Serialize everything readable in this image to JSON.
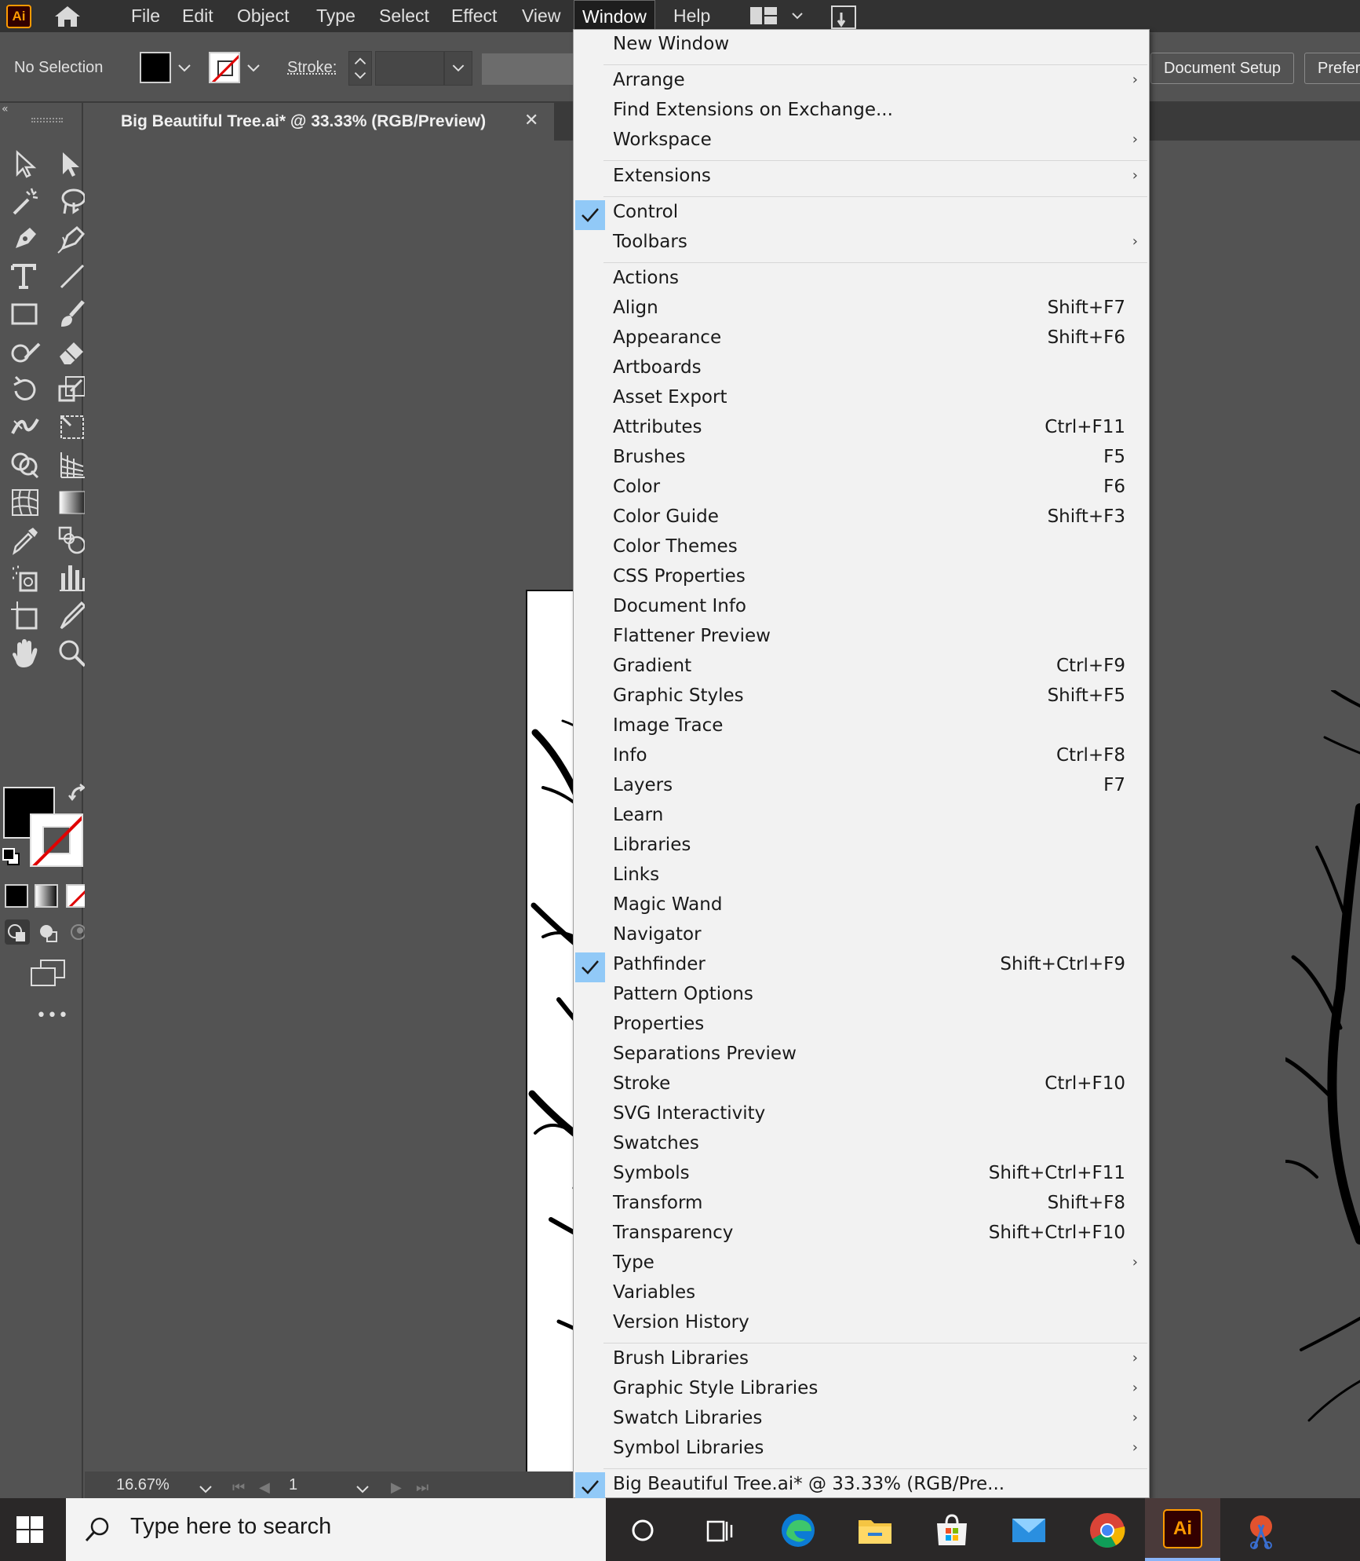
{
  "app": {
    "logo": "Ai",
    "home_icon": "home-icon"
  },
  "menubar": {
    "items": [
      "File",
      "Edit",
      "Object",
      "Type",
      "Select",
      "Effect",
      "View",
      "Window",
      "Help"
    ],
    "active": "Window"
  },
  "controlbar": {
    "selection_label": "No Selection",
    "fill_color": "#000000",
    "stroke_label": "Stroke:",
    "document_setup": "Document Setup",
    "preferences": "Prefer"
  },
  "document": {
    "tab_title": "Big Beautiful Tree.ai* @ 33.33% (RGB/Preview)",
    "close": "✕"
  },
  "statusbar": {
    "zoom": "16.67%",
    "page": "1"
  },
  "window_menu": {
    "items": [
      {
        "label": "New Window"
      },
      {
        "separator": true
      },
      {
        "label": "Arrange",
        "submenu": true
      },
      {
        "label": "Find Extensions on Exchange..."
      },
      {
        "label": "Workspace",
        "submenu": true
      },
      {
        "separator": true
      },
      {
        "label": "Extensions",
        "submenu": true
      },
      {
        "separator": true
      },
      {
        "label": "Control",
        "checked": true
      },
      {
        "label": "Toolbars",
        "submenu": true
      },
      {
        "separator": true
      },
      {
        "label": "Actions"
      },
      {
        "label": "Align",
        "shortcut": "Shift+F7"
      },
      {
        "label": "Appearance",
        "shortcut": "Shift+F6"
      },
      {
        "label": "Artboards"
      },
      {
        "label": "Asset Export"
      },
      {
        "label": "Attributes",
        "shortcut": "Ctrl+F11"
      },
      {
        "label": "Brushes",
        "shortcut": "F5"
      },
      {
        "label": "Color",
        "shortcut": "F6"
      },
      {
        "label": "Color Guide",
        "shortcut": "Shift+F3"
      },
      {
        "label": "Color Themes"
      },
      {
        "label": "CSS Properties"
      },
      {
        "label": "Document Info"
      },
      {
        "label": "Flattener Preview"
      },
      {
        "label": "Gradient",
        "shortcut": "Ctrl+F9"
      },
      {
        "label": "Graphic Styles",
        "shortcut": "Shift+F5"
      },
      {
        "label": "Image Trace"
      },
      {
        "label": "Info",
        "shortcut": "Ctrl+F8"
      },
      {
        "label": "Layers",
        "shortcut": "F7"
      },
      {
        "label": "Learn"
      },
      {
        "label": "Libraries"
      },
      {
        "label": "Links"
      },
      {
        "label": "Magic Wand"
      },
      {
        "label": "Navigator"
      },
      {
        "label": "Pathfinder",
        "shortcut": "Shift+Ctrl+F9",
        "checked": true
      },
      {
        "label": "Pattern Options"
      },
      {
        "label": "Properties"
      },
      {
        "label": "Separations Preview"
      },
      {
        "label": "Stroke",
        "shortcut": "Ctrl+F10"
      },
      {
        "label": "SVG Interactivity"
      },
      {
        "label": "Swatches"
      },
      {
        "label": "Symbols",
        "shortcut": "Shift+Ctrl+F11"
      },
      {
        "label": "Transform",
        "shortcut": "Shift+F8"
      },
      {
        "label": "Transparency",
        "shortcut": "Shift+Ctrl+F10"
      },
      {
        "label": "Type",
        "submenu": true
      },
      {
        "label": "Variables"
      },
      {
        "label": "Version History"
      },
      {
        "separator": true
      },
      {
        "label": "Brush Libraries",
        "submenu": true
      },
      {
        "label": "Graphic Style Libraries",
        "submenu": true
      },
      {
        "label": "Swatch Libraries",
        "submenu": true
      },
      {
        "label": "Symbol Libraries",
        "submenu": true
      },
      {
        "separator": true
      },
      {
        "label": "Big Beautiful Tree.ai* @ 33.33% (RGB/Pre...",
        "checked": true
      }
    ]
  },
  "taskbar": {
    "search_placeholder": "Type here to search",
    "apps": [
      "cortana-icon",
      "task-view-icon",
      "edge-icon",
      "file-explorer-icon",
      "store-icon",
      "mail-icon",
      "chrome-icon",
      "illustrator-icon",
      "snip-icon"
    ],
    "illustrator_label": "Ai"
  }
}
